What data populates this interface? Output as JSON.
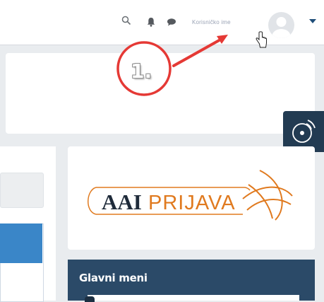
{
  "navbar": {
    "username": "Korisničko ime",
    "icons": [
      "search-icon",
      "bell-icon",
      "chat-icon",
      "avatar-icon",
      "caret-down-icon"
    ]
  },
  "annotation": {
    "step_label": "1.",
    "color": "#e53935"
  },
  "login_card": {
    "logo_text_bold": "AAI",
    "logo_text_light": "PRIJAVA"
  },
  "menu": {
    "title": "Glavni meni"
  },
  "colors": {
    "navy": "#2b4a68",
    "accent_orange": "#e07a1f",
    "link_blue": "#3a86c8"
  }
}
